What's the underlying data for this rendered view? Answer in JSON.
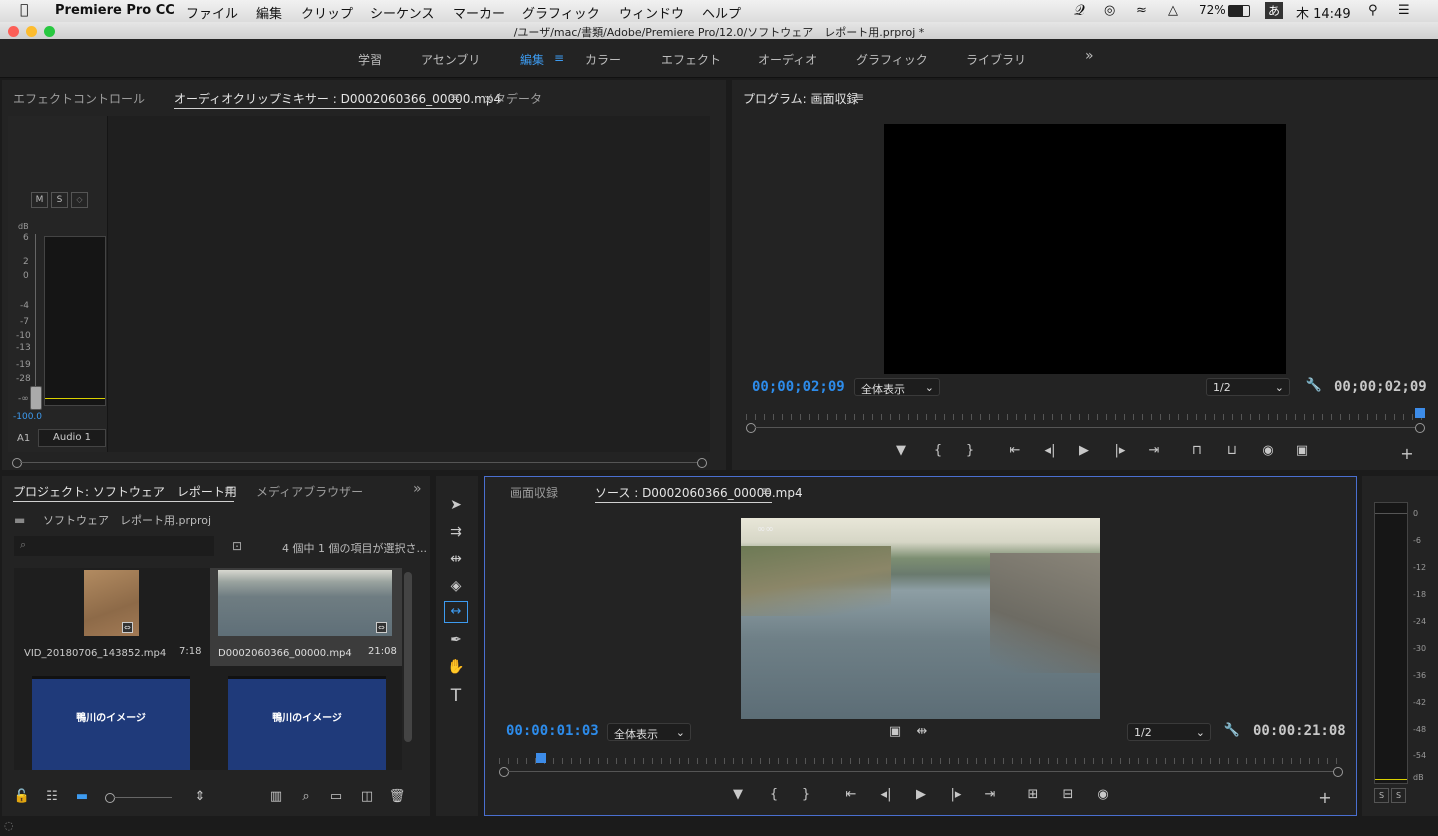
{
  "menubar": {
    "app": "Premiere Pro CC",
    "items": [
      "ファイル",
      "編集",
      "クリップ",
      "シーケンス",
      "マーカー",
      "グラフィック",
      "ウィンドウ",
      "ヘルプ"
    ],
    "battery": "72%",
    "ime": "あ",
    "clock": "木 14:49"
  },
  "window": {
    "title": "/ユーザ/mac/書類/Adobe/Premiere Pro/12.0/ソフトウェア　レポート用.prproj *"
  },
  "workspaces": {
    "items": [
      "学習",
      "アセンブリ",
      "編集",
      "カラー",
      "エフェクト",
      "オーディオ",
      "グラフィック",
      "ライブラリ"
    ],
    "active": "編集",
    "more": "»"
  },
  "top_left": {
    "tabs": [
      "エフェクトコントロール",
      "オーディオクリップミキサー : D0002060366_00000.mp4",
      "メタデータ"
    ],
    "mixer": {
      "buttons": [
        "M",
        "S",
        "◇"
      ],
      "db_label": "dB",
      "scale": [
        "6",
        "2",
        "0",
        "-4",
        "-7",
        "-10",
        "-13",
        "-19",
        "-28",
        "-∞"
      ],
      "value": "-100.0",
      "track": "A1",
      "track_name": "Audio 1"
    }
  },
  "program": {
    "title": "プログラム: 画面収録",
    "timecode": "00;00;02;09",
    "fit": "全体表示",
    "res": "1/2",
    "duration": "00;00;02;09"
  },
  "project": {
    "tabs": [
      "プロジェクト: ソフトウェア　レポート用",
      "メディアブラウザー"
    ],
    "file": "ソフトウェア　レポート用.prproj",
    "status": "4 個中 1 個の項目が選択さ...",
    "items": [
      {
        "name": "VID_20180706_143852.mp4",
        "dur": "7:18"
      },
      {
        "name": "D0002060366_00000.mp4",
        "dur": "21:08"
      },
      {
        "name": "",
        "dur": "",
        "slide": "鴨川のイメージ"
      },
      {
        "name": "",
        "dur": "",
        "slide": "鴨川のイメージ"
      }
    ]
  },
  "source": {
    "tabs": [
      "画面収録",
      "ソース : D0002060366_00000.mp4"
    ],
    "timecode": "00:00:01:03",
    "fit": "全体表示",
    "res": "1/2",
    "duration": "00:00:21:08",
    "progress": 0.05
  },
  "meter": {
    "scale": [
      "0",
      "-6",
      "-12",
      "-18",
      "-24",
      "-30",
      "-36",
      "-42",
      "-48",
      "-54",
      "dB"
    ],
    "solo": [
      "S",
      "S"
    ]
  },
  "colors": {
    "accent": "#2d8ceb",
    "panel": "#232323",
    "bg": "#1b1b1b"
  }
}
